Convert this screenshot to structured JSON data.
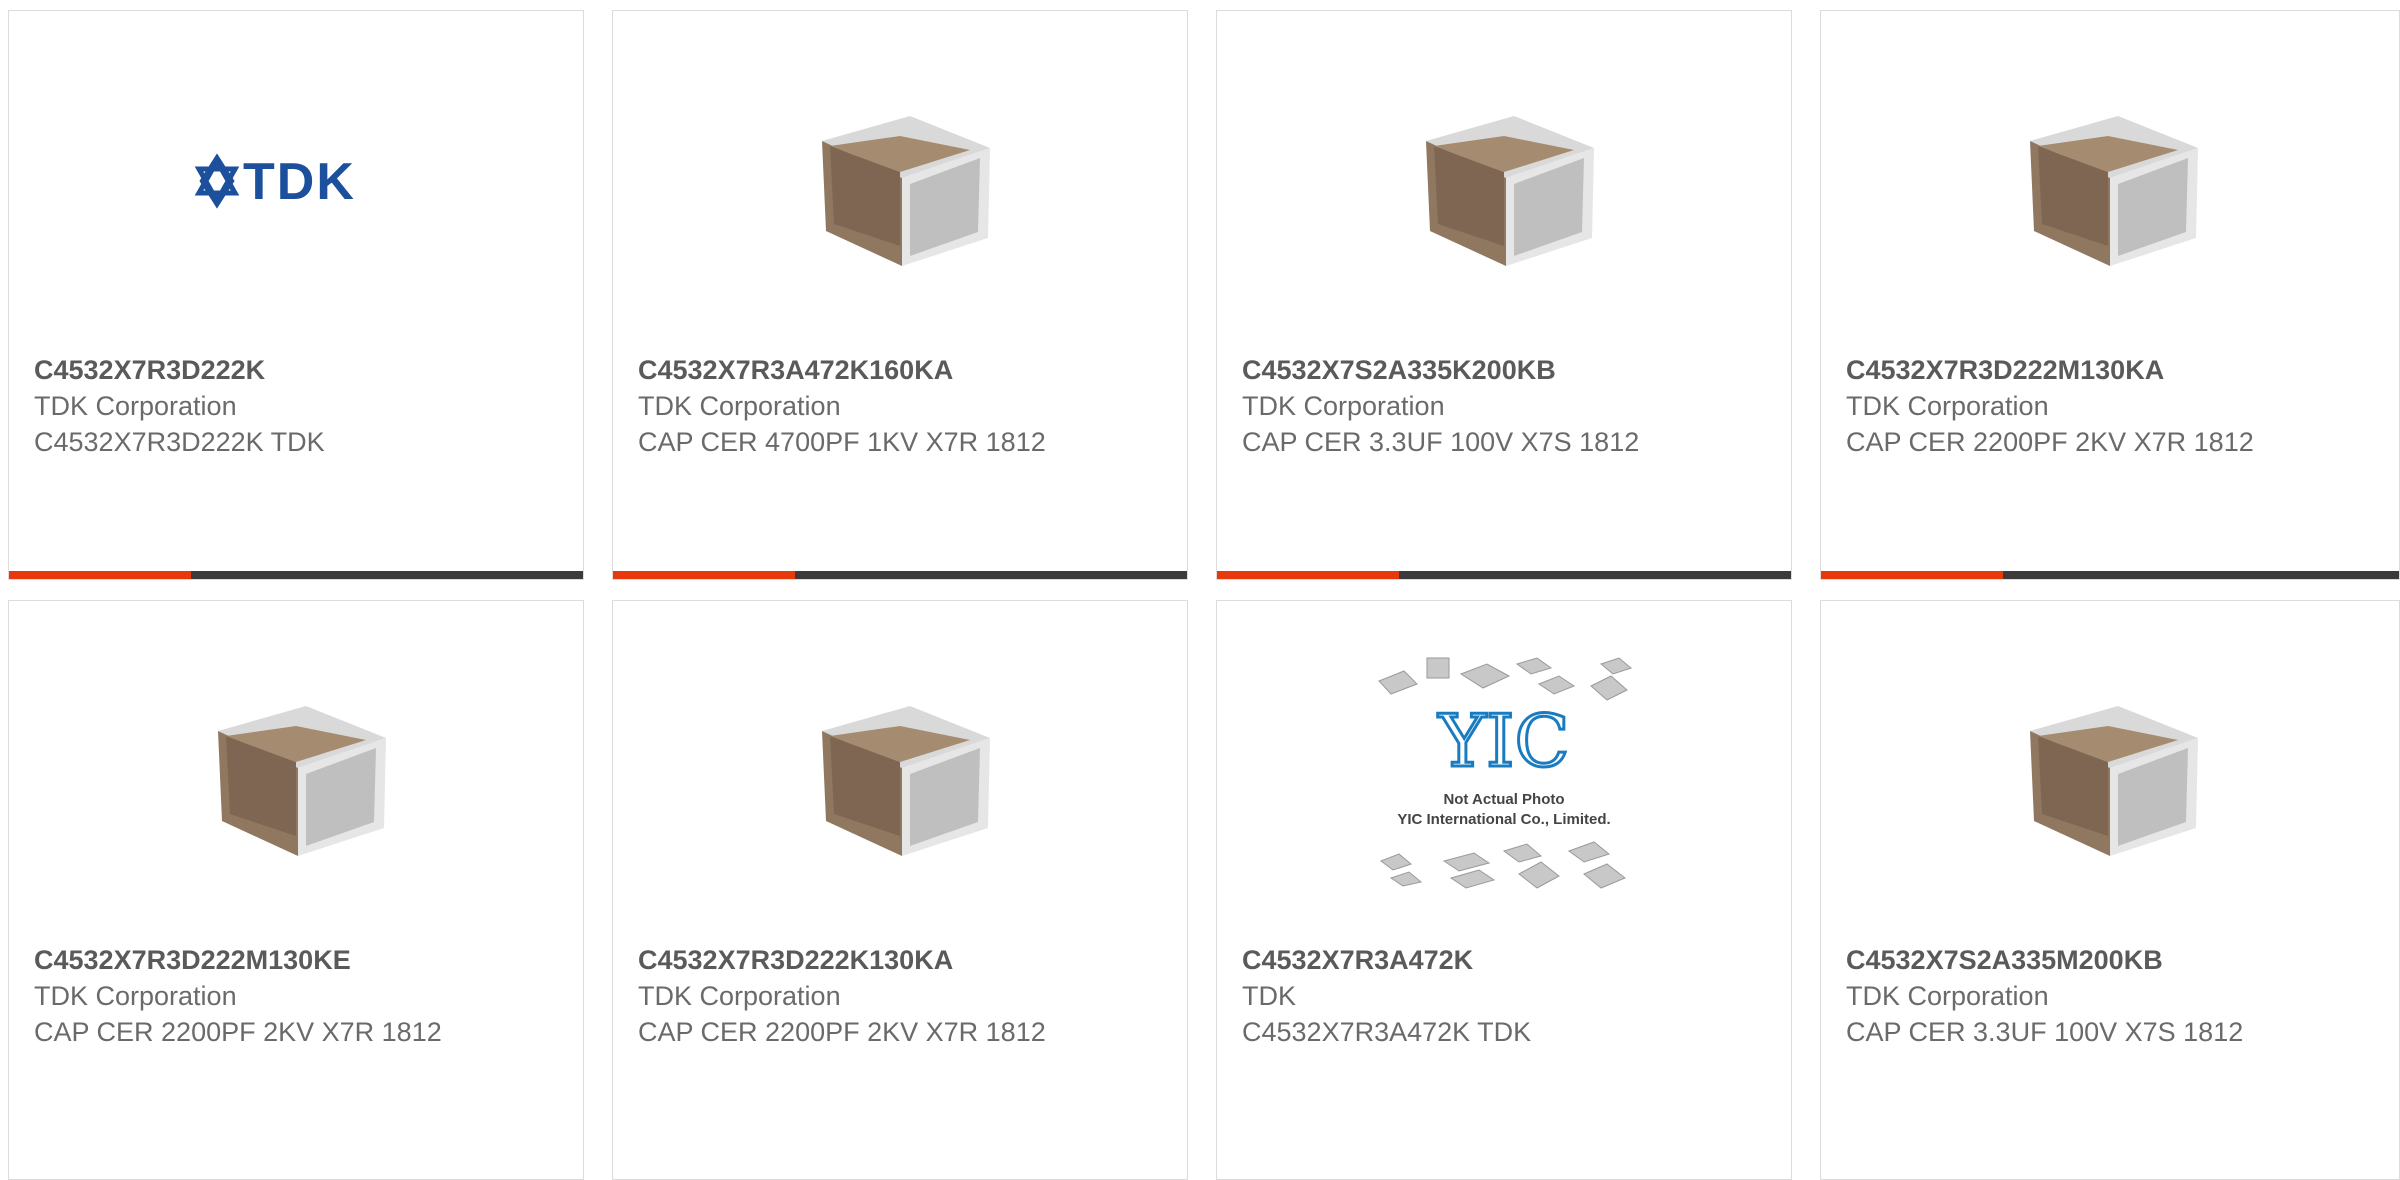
{
  "colors": {
    "accent": "#e8380d",
    "bar": "#3b3b3b",
    "border": "#dcdcdc",
    "part_text": "#5a5a5a",
    "desc_text": "#6a6a6a"
  },
  "cards": [
    {
      "part_number": "C4532X7R3D222K",
      "manufacturer": "TDK Corporation",
      "description": "C4532X7R3D222K TDK",
      "image": "tdk-logo",
      "logo_text": "TDK",
      "has_bar": true
    },
    {
      "part_number": "C4532X7R3A472K160KA",
      "manufacturer": "TDK Corporation",
      "description": "CAP CER 4700PF 1KV X7R 1812",
      "image": "mlcc-chip-photo",
      "has_bar": true
    },
    {
      "part_number": "C4532X7S2A335K200KB",
      "manufacturer": "TDK Corporation",
      "description": "CAP CER 3.3UF 100V X7S 1812",
      "image": "mlcc-chip-photo",
      "has_bar": true
    },
    {
      "part_number": "C4532X7R3D222M130KA",
      "manufacturer": "TDK Corporation",
      "description": "CAP CER 2200PF 2KV X7R 1812",
      "image": "mlcc-chip-photo",
      "has_bar": true
    },
    {
      "part_number": "C4532X7R3D222M130KE",
      "manufacturer": "TDK Corporation",
      "description": "CAP CER 2200PF 2KV X7R 1812",
      "image": "mlcc-chip-photo",
      "has_bar": false
    },
    {
      "part_number": "C4532X7R3D222K130KA",
      "manufacturer": "TDK Corporation",
      "description": "CAP CER 2200PF 2KV X7R 1812",
      "image": "mlcc-chip-photo",
      "has_bar": false
    },
    {
      "part_number": "C4532X7R3A472K",
      "manufacturer": "TDK",
      "description": "C4532X7R3A472K TDK",
      "image": "not-actual-photo-placeholder",
      "placeholder_logo": "YIC",
      "placeholder_line1": "Not Actual Photo",
      "placeholder_line2": "YIC International Co., Limited.",
      "has_bar": false
    },
    {
      "part_number": "C4532X7S2A335M200KB",
      "manufacturer": "TDK Corporation",
      "description": "CAP CER 3.3UF 100V X7S 1812",
      "image": "mlcc-chip-photo",
      "has_bar": false
    }
  ]
}
